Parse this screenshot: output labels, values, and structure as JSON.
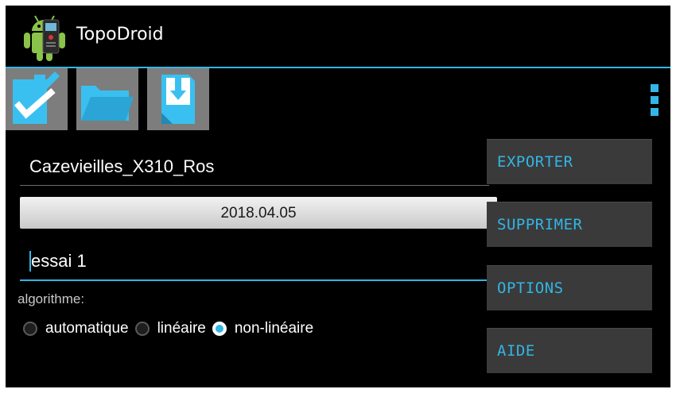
{
  "app": {
    "title": "TopoDroid",
    "icon": "android-robot-icon"
  },
  "toolbar": {
    "buttons": [
      {
        "name": "save-button",
        "icon": "checkbox-check-icon"
      },
      {
        "name": "open-folder-button",
        "icon": "folder-icon"
      },
      {
        "name": "import-button",
        "icon": "document-download-icon"
      }
    ],
    "overflow_icon": "more-vertical-icon"
  },
  "form": {
    "survey_name": "Cazevieilles_X310_Ros",
    "date": "2018.04.05",
    "comment": "essai 1",
    "algorithm_label": "algorithme:",
    "algorithms": [
      {
        "label": "automatique",
        "checked": false
      },
      {
        "label": "linéaire",
        "checked": false
      },
      {
        "label": "non-linéaire",
        "checked": true
      }
    ]
  },
  "menu": {
    "items": [
      "EXPORTER",
      "SUPPRIMER",
      "OPTIONS",
      "AIDE"
    ]
  },
  "colors": {
    "accent": "#33b5e5",
    "background": "#000000",
    "button_gray": "#7d7d7d",
    "menu_background": "#3a3a3a"
  }
}
